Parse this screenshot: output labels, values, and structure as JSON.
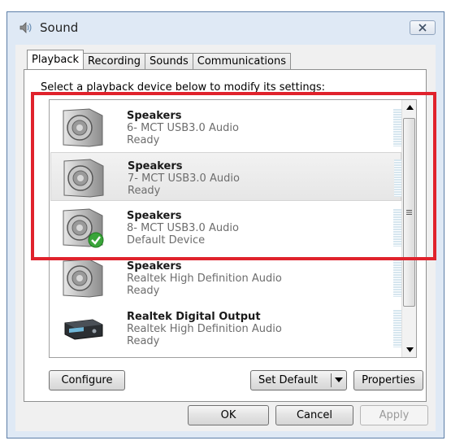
{
  "window": {
    "title": "Sound",
    "icon": "speaker-icon",
    "close_icon": "close-icon"
  },
  "tabs": [
    {
      "label": "Playback",
      "active": true
    },
    {
      "label": "Recording",
      "active": false
    },
    {
      "label": "Sounds",
      "active": false
    },
    {
      "label": "Communications",
      "active": false
    }
  ],
  "instruction": "Select a playback device below to modify its settings:",
  "devices": [
    {
      "name": "Speakers",
      "description": "6- MCT USB3.0 Audio",
      "status": "Ready",
      "icon": "speaker-icon",
      "selected": false,
      "default": false
    },
    {
      "name": "Speakers",
      "description": "7- MCT USB3.0 Audio",
      "status": "Ready",
      "icon": "speaker-icon",
      "selected": true,
      "default": false
    },
    {
      "name": "Speakers",
      "description": "8- MCT USB3.0 Audio",
      "status": "Default Device",
      "icon": "speaker-icon",
      "selected": false,
      "default": true
    },
    {
      "name": "Speakers",
      "description": "Realtek High Definition Audio",
      "status": "Ready",
      "icon": "speaker-icon",
      "selected": false,
      "default": false
    },
    {
      "name": "Realtek Digital Output",
      "description": "Realtek High Definition Audio",
      "status": "Ready",
      "icon": "digital-output-icon",
      "selected": false,
      "default": false
    }
  ],
  "buttons": {
    "configure": "Configure",
    "set_default": "Set Default",
    "properties": "Properties",
    "ok": "OK",
    "cancel": "Cancel",
    "apply": "Apply"
  },
  "colors": {
    "highlight": "#e0222c",
    "default_check": "#3aa53a"
  }
}
